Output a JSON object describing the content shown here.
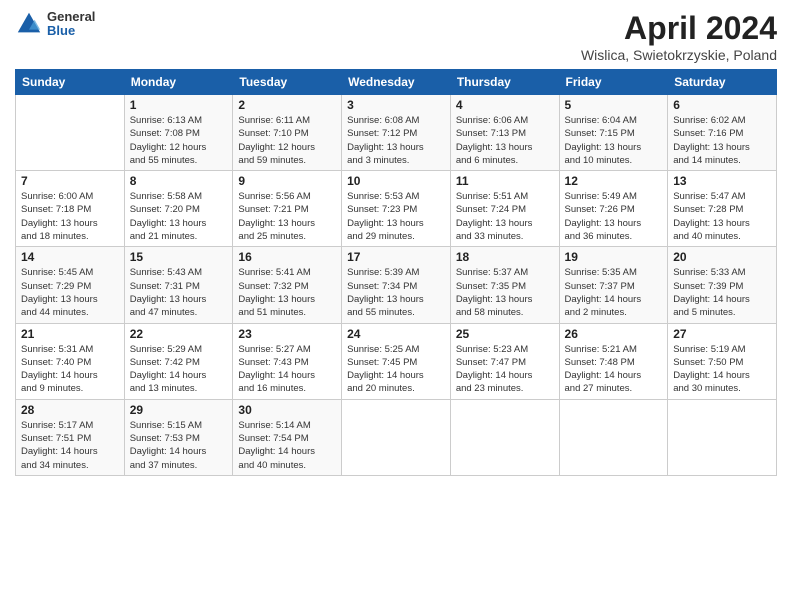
{
  "header": {
    "logo_general": "General",
    "logo_blue": "Blue",
    "month_title": "April 2024",
    "subtitle": "Wislica, Swietokrzyskie, Poland"
  },
  "days_of_week": [
    "Sunday",
    "Monday",
    "Tuesday",
    "Wednesday",
    "Thursday",
    "Friday",
    "Saturday"
  ],
  "weeks": [
    [
      {
        "day": "",
        "info": ""
      },
      {
        "day": "1",
        "info": "Sunrise: 6:13 AM\nSunset: 7:08 PM\nDaylight: 12 hours\nand 55 minutes."
      },
      {
        "day": "2",
        "info": "Sunrise: 6:11 AM\nSunset: 7:10 PM\nDaylight: 12 hours\nand 59 minutes."
      },
      {
        "day": "3",
        "info": "Sunrise: 6:08 AM\nSunset: 7:12 PM\nDaylight: 13 hours\nand 3 minutes."
      },
      {
        "day": "4",
        "info": "Sunrise: 6:06 AM\nSunset: 7:13 PM\nDaylight: 13 hours\nand 6 minutes."
      },
      {
        "day": "5",
        "info": "Sunrise: 6:04 AM\nSunset: 7:15 PM\nDaylight: 13 hours\nand 10 minutes."
      },
      {
        "day": "6",
        "info": "Sunrise: 6:02 AM\nSunset: 7:16 PM\nDaylight: 13 hours\nand 14 minutes."
      }
    ],
    [
      {
        "day": "7",
        "info": "Sunrise: 6:00 AM\nSunset: 7:18 PM\nDaylight: 13 hours\nand 18 minutes."
      },
      {
        "day": "8",
        "info": "Sunrise: 5:58 AM\nSunset: 7:20 PM\nDaylight: 13 hours\nand 21 minutes."
      },
      {
        "day": "9",
        "info": "Sunrise: 5:56 AM\nSunset: 7:21 PM\nDaylight: 13 hours\nand 25 minutes."
      },
      {
        "day": "10",
        "info": "Sunrise: 5:53 AM\nSunset: 7:23 PM\nDaylight: 13 hours\nand 29 minutes."
      },
      {
        "day": "11",
        "info": "Sunrise: 5:51 AM\nSunset: 7:24 PM\nDaylight: 13 hours\nand 33 minutes."
      },
      {
        "day": "12",
        "info": "Sunrise: 5:49 AM\nSunset: 7:26 PM\nDaylight: 13 hours\nand 36 minutes."
      },
      {
        "day": "13",
        "info": "Sunrise: 5:47 AM\nSunset: 7:28 PM\nDaylight: 13 hours\nand 40 minutes."
      }
    ],
    [
      {
        "day": "14",
        "info": "Sunrise: 5:45 AM\nSunset: 7:29 PM\nDaylight: 13 hours\nand 44 minutes."
      },
      {
        "day": "15",
        "info": "Sunrise: 5:43 AM\nSunset: 7:31 PM\nDaylight: 13 hours\nand 47 minutes."
      },
      {
        "day": "16",
        "info": "Sunrise: 5:41 AM\nSunset: 7:32 PM\nDaylight: 13 hours\nand 51 minutes."
      },
      {
        "day": "17",
        "info": "Sunrise: 5:39 AM\nSunset: 7:34 PM\nDaylight: 13 hours\nand 55 minutes."
      },
      {
        "day": "18",
        "info": "Sunrise: 5:37 AM\nSunset: 7:35 PM\nDaylight: 13 hours\nand 58 minutes."
      },
      {
        "day": "19",
        "info": "Sunrise: 5:35 AM\nSunset: 7:37 PM\nDaylight: 14 hours\nand 2 minutes."
      },
      {
        "day": "20",
        "info": "Sunrise: 5:33 AM\nSunset: 7:39 PM\nDaylight: 14 hours\nand 5 minutes."
      }
    ],
    [
      {
        "day": "21",
        "info": "Sunrise: 5:31 AM\nSunset: 7:40 PM\nDaylight: 14 hours\nand 9 minutes."
      },
      {
        "day": "22",
        "info": "Sunrise: 5:29 AM\nSunset: 7:42 PM\nDaylight: 14 hours\nand 13 minutes."
      },
      {
        "day": "23",
        "info": "Sunrise: 5:27 AM\nSunset: 7:43 PM\nDaylight: 14 hours\nand 16 minutes."
      },
      {
        "day": "24",
        "info": "Sunrise: 5:25 AM\nSunset: 7:45 PM\nDaylight: 14 hours\nand 20 minutes."
      },
      {
        "day": "25",
        "info": "Sunrise: 5:23 AM\nSunset: 7:47 PM\nDaylight: 14 hours\nand 23 minutes."
      },
      {
        "day": "26",
        "info": "Sunrise: 5:21 AM\nSunset: 7:48 PM\nDaylight: 14 hours\nand 27 minutes."
      },
      {
        "day": "27",
        "info": "Sunrise: 5:19 AM\nSunset: 7:50 PM\nDaylight: 14 hours\nand 30 minutes."
      }
    ],
    [
      {
        "day": "28",
        "info": "Sunrise: 5:17 AM\nSunset: 7:51 PM\nDaylight: 14 hours\nand 34 minutes."
      },
      {
        "day": "29",
        "info": "Sunrise: 5:15 AM\nSunset: 7:53 PM\nDaylight: 14 hours\nand 37 minutes."
      },
      {
        "day": "30",
        "info": "Sunrise: 5:14 AM\nSunset: 7:54 PM\nDaylight: 14 hours\nand 40 minutes."
      },
      {
        "day": "",
        "info": ""
      },
      {
        "day": "",
        "info": ""
      },
      {
        "day": "",
        "info": ""
      },
      {
        "day": "",
        "info": ""
      }
    ]
  ]
}
